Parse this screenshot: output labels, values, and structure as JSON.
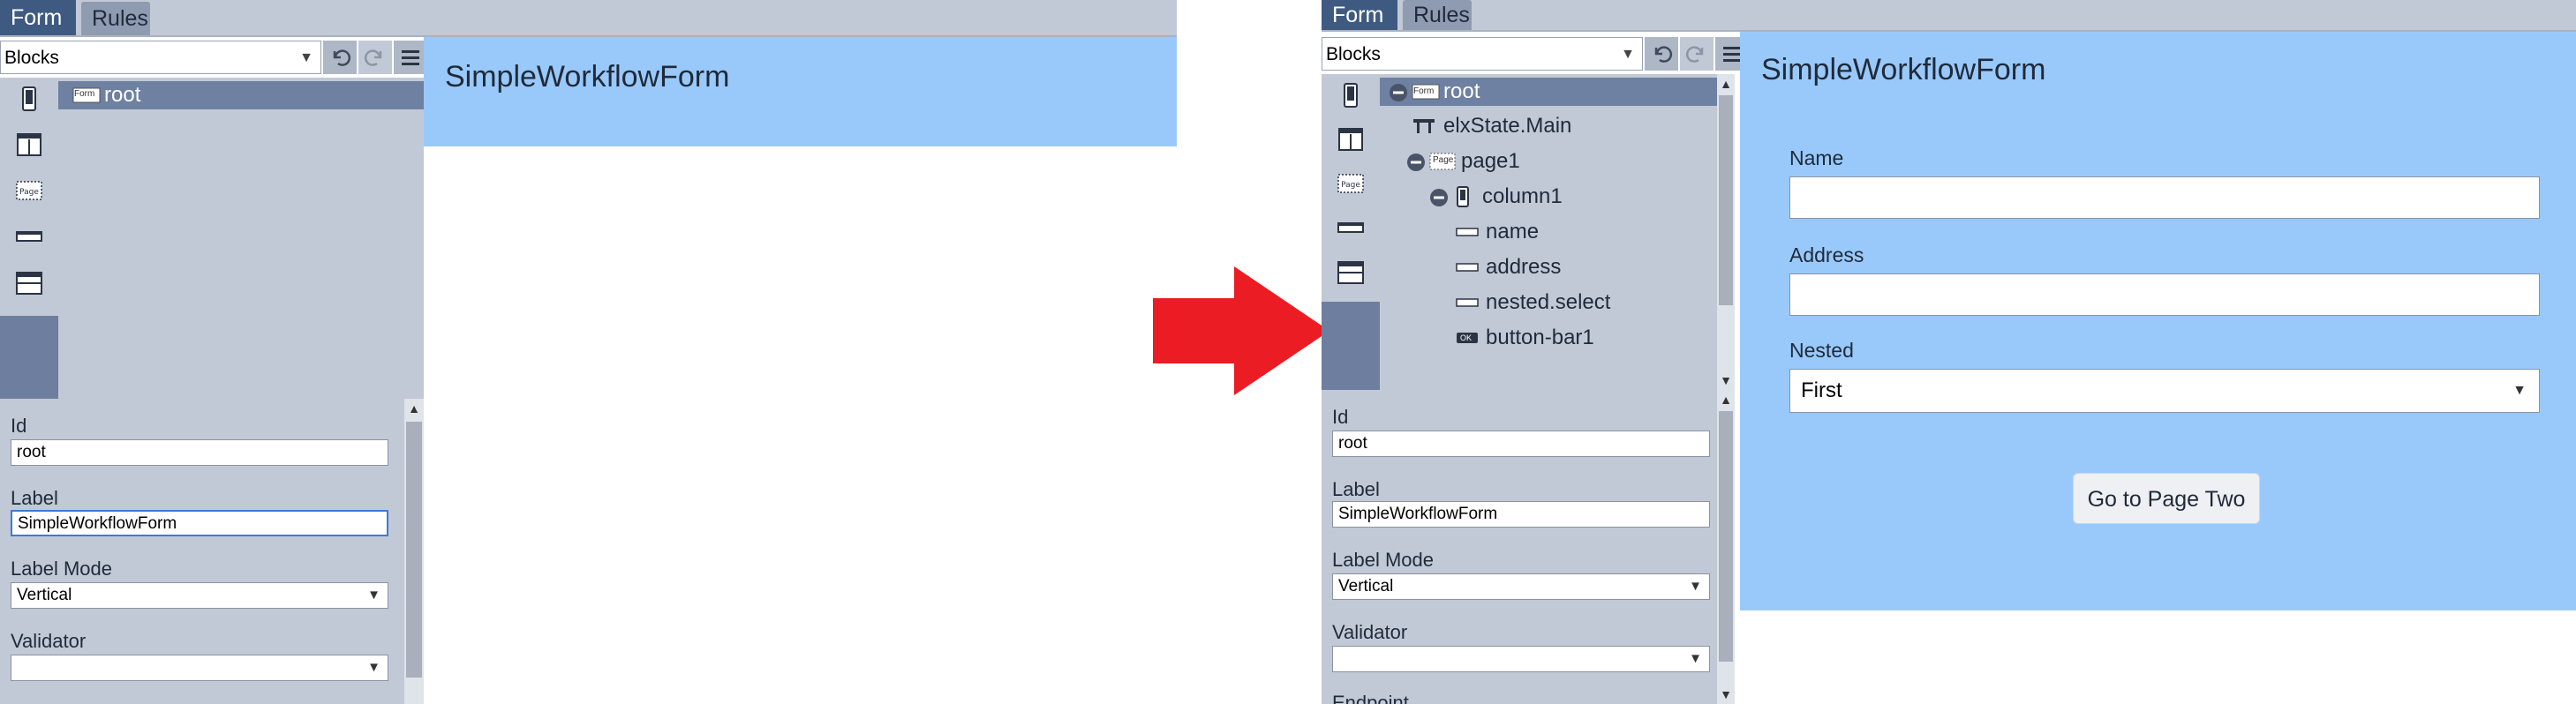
{
  "before": {
    "tabs": [
      {
        "label": "Form",
        "active": true
      },
      {
        "label": "Rules",
        "active": false
      }
    ],
    "toolbar": {
      "blocks_value": "Blocks"
    },
    "tree": [
      {
        "label": "root",
        "badge": "Form",
        "selected": true
      }
    ],
    "props": {
      "id_label": "Id",
      "id_value": "root",
      "label_label": "Label",
      "label_value": "SimpleWorkflowForm",
      "label_mode_label": "Label Mode",
      "label_mode_value": "Vertical",
      "validator_label": "Validator",
      "validator_value": ""
    },
    "canvas": {
      "title": "SimpleWorkflowForm"
    }
  },
  "after": {
    "tabs": [
      {
        "label": "Form",
        "active": true
      },
      {
        "label": "Rules",
        "active": false
      }
    ],
    "toolbar": {
      "blocks_value": "Blocks"
    },
    "tree": [
      {
        "label": "root",
        "badge": "Form",
        "selected": true
      },
      {
        "label": "elxState.Main"
      },
      {
        "label": "page1",
        "badge": "Page"
      },
      {
        "label": "column1"
      },
      {
        "label": "name"
      },
      {
        "label": "address"
      },
      {
        "label": "nested.select"
      },
      {
        "label": "button-bar1",
        "badge": "OK"
      }
    ],
    "props": {
      "id_label": "Id",
      "id_value": "root",
      "label_label": "Label",
      "label_value": "SimpleWorkflowForm",
      "label_mode_label": "Label Mode",
      "label_mode_value": "Vertical",
      "validator_label": "Validator",
      "validator_value": "",
      "endpoint_label": "Endpoint"
    },
    "canvas": {
      "title": "SimpleWorkflowForm",
      "name_label": "Name",
      "name_value": "",
      "address_label": "Address",
      "address_value": "",
      "nested_label": "Nested",
      "nested_value": "First",
      "button_label": "Go to Page Two"
    }
  },
  "palette_icons": [
    "column-icon",
    "columns-icon",
    "page-icon",
    "field-icon",
    "section-icon"
  ],
  "colors": {
    "accent": "#3f5a80",
    "canvas": "#99c9fa",
    "panel": "#c2c9d6",
    "arrow": "#ec1c24"
  }
}
